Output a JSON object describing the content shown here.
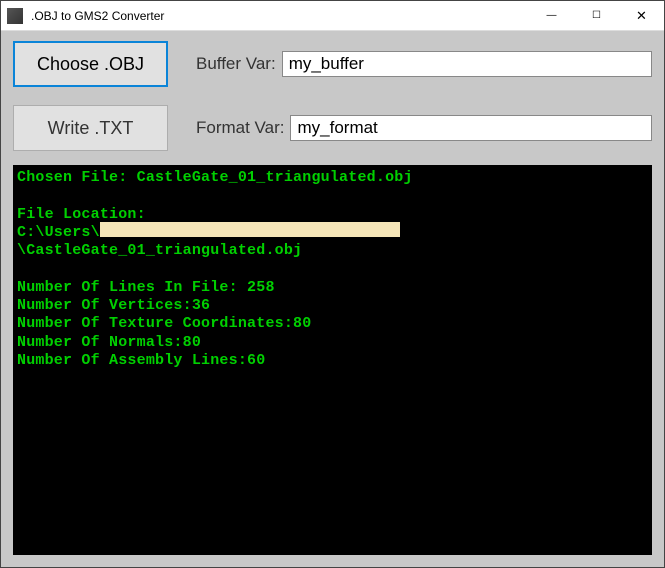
{
  "app": {
    "title": ".OBJ to GMS2 Converter"
  },
  "buttons": {
    "choose_obj": "Choose .OBJ",
    "write_txt": "Write .TXT"
  },
  "fields": {
    "buffer": {
      "label": "Buffer Var:",
      "value": "my_buffer"
    },
    "format": {
      "label": "Format Var:",
      "value": "my_format"
    }
  },
  "console": {
    "chosen_file_label": "Chosen File:",
    "chosen_file_name": "CastleGate_01_triangulated.obj",
    "file_location_label": "File Location:",
    "path_prefix": "C:\\Users\\",
    "path_suffix": "\\CastleGate_01_triangulated.obj",
    "stats": {
      "lines_label": "Number Of Lines In File:",
      "lines": 258,
      "verts_label": "Number Of Vertices:",
      "verts": 36,
      "tex_label": "Number Of Texture Coordinates:",
      "tex": 80,
      "normals_label": "Number Of Normals:",
      "normals": 80,
      "assembly_label": "Number Of Assembly Lines:",
      "assembly": 60
    }
  },
  "win_controls": {
    "minimize": "—",
    "maximize": "☐",
    "close": "✕"
  }
}
